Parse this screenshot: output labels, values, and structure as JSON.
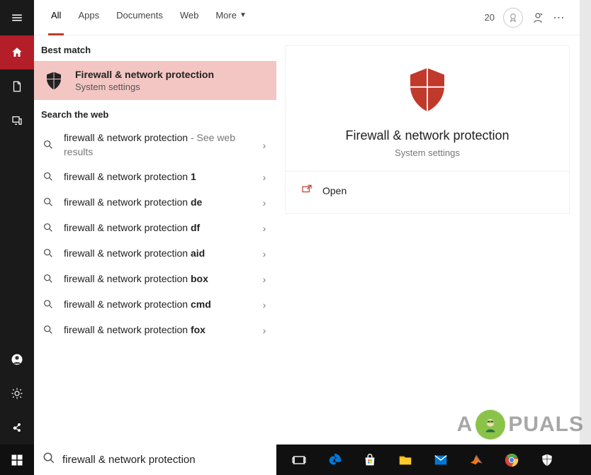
{
  "sidebar": {
    "items": [
      "menu",
      "home",
      "document",
      "devices"
    ],
    "bottom": [
      "user",
      "settings",
      "share"
    ]
  },
  "tabs": {
    "all": "All",
    "apps": "Apps",
    "documents": "Documents",
    "web": "Web",
    "more": "More"
  },
  "header": {
    "points": "20"
  },
  "sections": {
    "best_match": "Best match",
    "search_web": "Search the web"
  },
  "best_match": {
    "title": "Firewall & network protection",
    "subtitle": "System settings"
  },
  "web_results": [
    {
      "base": "firewall & network protection",
      "suffix": "",
      "extra": " - See web results"
    },
    {
      "base": "firewall & network protection ",
      "suffix": "1",
      "extra": ""
    },
    {
      "base": "firewall & network protection ",
      "suffix": "de",
      "extra": ""
    },
    {
      "base": "firewall & network protection ",
      "suffix": "df",
      "extra": ""
    },
    {
      "base": "firewall & network protection ",
      "suffix": "aid",
      "extra": ""
    },
    {
      "base": "firewall & network protection ",
      "suffix": "box",
      "extra": ""
    },
    {
      "base": "firewall & network protection ",
      "suffix": "cmd",
      "extra": ""
    },
    {
      "base": "firewall & network protection ",
      "suffix": "fox",
      "extra": ""
    }
  ],
  "preview": {
    "title": "Firewall & network protection",
    "subtitle": "System settings",
    "open": "Open"
  },
  "search": {
    "value": "firewall & network protection"
  },
  "watermark": {
    "pre": "A",
    "post": "PUALS"
  }
}
